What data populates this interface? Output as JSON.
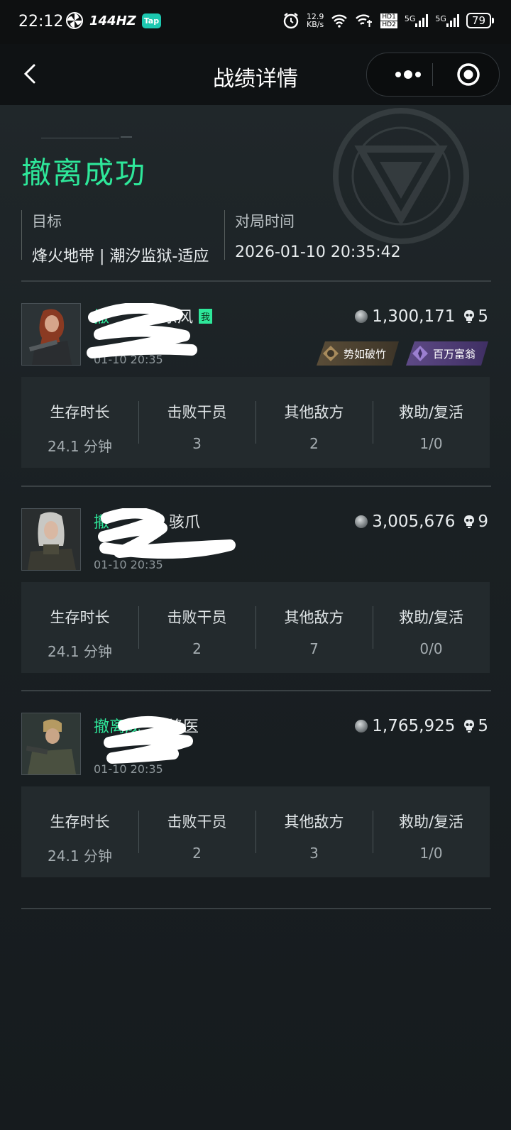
{
  "status_bar": {
    "time": "22:12",
    "refresh_rate": "144HZ",
    "tap_badge": "Tap",
    "net_speed": "12.9",
    "net_unit": "KB/s",
    "hd1": "HD1",
    "hd2": "HD2",
    "sim1": "5G",
    "sim2": "5G",
    "battery": "79"
  },
  "nav": {
    "title": "战绩详情"
  },
  "header": {
    "result": "撤离成功",
    "target_label": "目标",
    "target_value": "烽火地带 | 潮汐监狱-适应",
    "time_label": "对局时间",
    "time_value": "2026-01-10 20:35:42"
  },
  "colors": {
    "accent_green": "#2ee79a",
    "background": "#1a2023"
  },
  "stat_labels": [
    "生存时长",
    "击败干员",
    "其他敌方",
    "救助/复活"
  ],
  "players": [
    {
      "name_prefix": "撤",
      "name_suffix": "东风",
      "me_badge": "我",
      "sub": "01-10 20:35",
      "value": "1,300,171",
      "kills": "5",
      "tags": [
        "势如破竹",
        "百万富翁"
      ],
      "stats": [
        "24.1 分钟",
        "3",
        "2",
        "1/0"
      ]
    },
    {
      "name_prefix": "撤",
      "name_suffix": "骇爪",
      "sub": "01-10 20:35",
      "value": "3,005,676",
      "kills": "9",
      "stats": [
        "24.1 分钟",
        "2",
        "7",
        "0/0"
      ]
    },
    {
      "name_prefix": "撤离成",
      "name_suffix": "蜂医",
      "sub": "01-10 20:35",
      "value": "1,765,925",
      "kills": "5",
      "stats": [
        "24.1 分钟",
        "2",
        "3",
        "1/0"
      ]
    }
  ]
}
